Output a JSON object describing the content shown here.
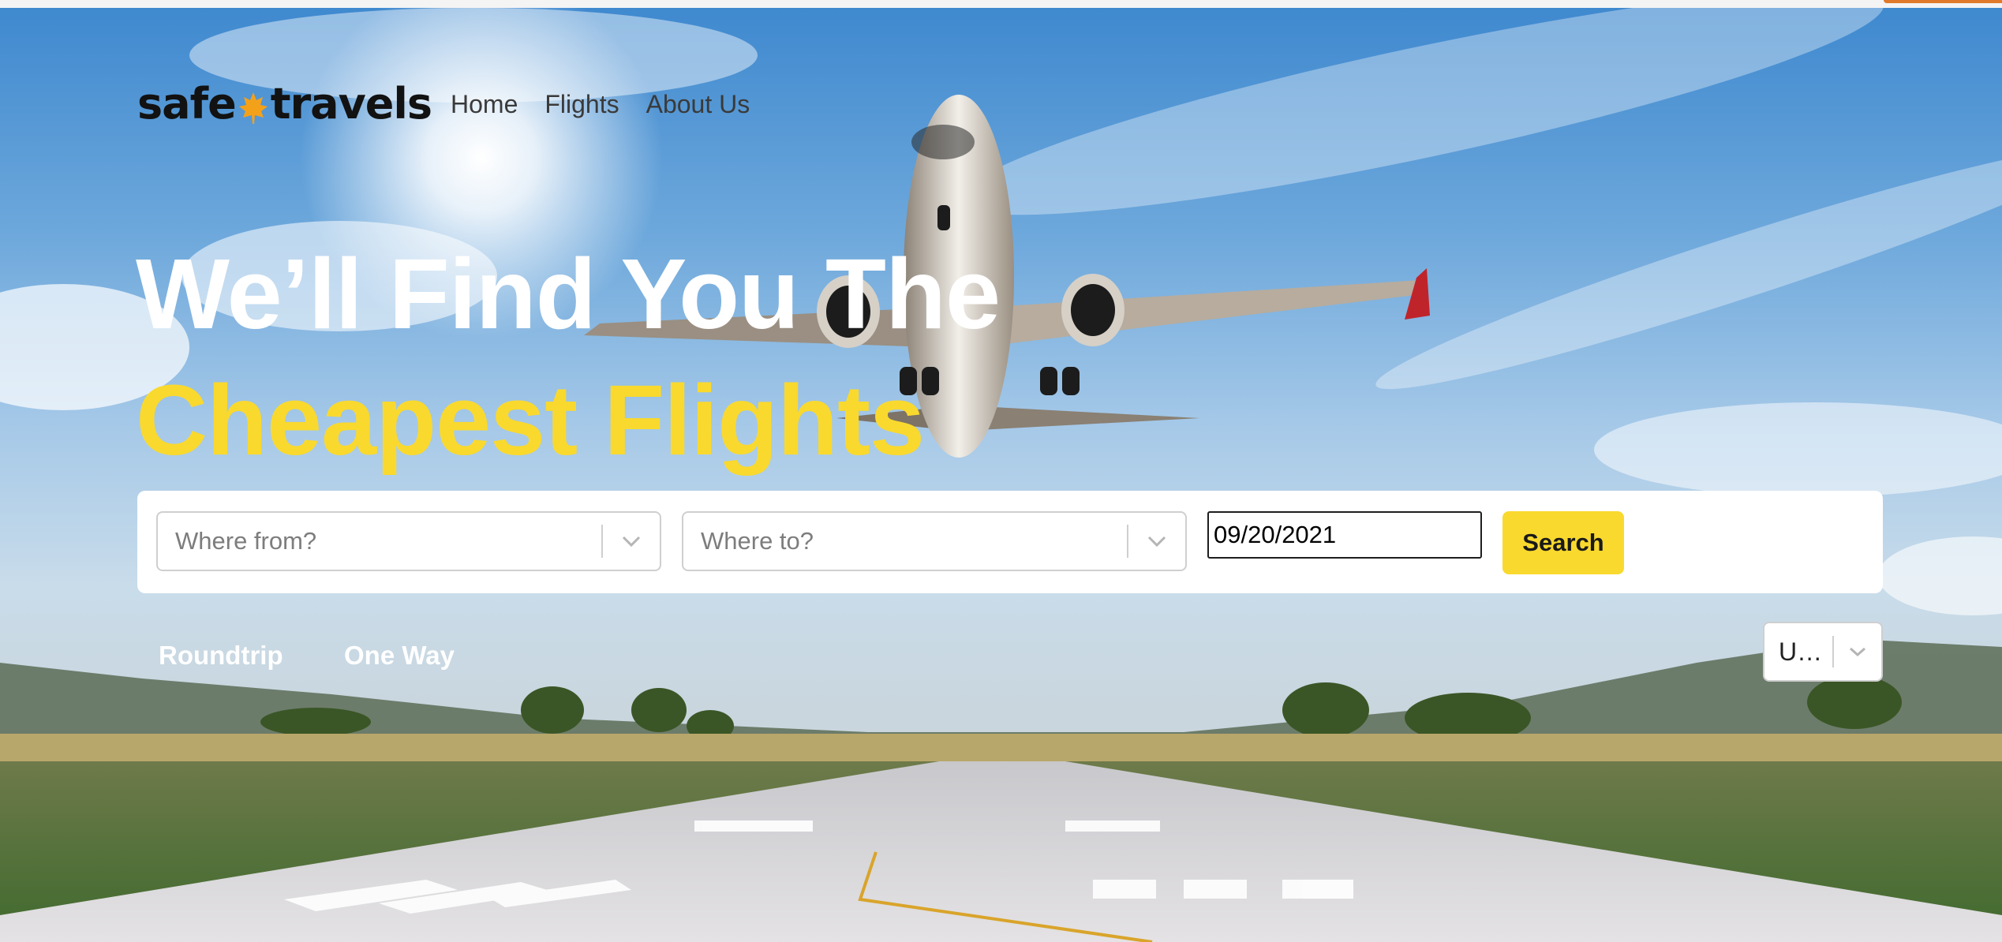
{
  "brand": {
    "name_part_1": "safe",
    "name_part_2": "travels",
    "accent_color": "#f9d92e",
    "logo_leaf_color": "#f4a11a",
    "logo_icon": "maple-leaf-icon"
  },
  "nav": {
    "items": [
      {
        "label": "Home"
      },
      {
        "label": "Flights"
      },
      {
        "label": "About Us"
      }
    ]
  },
  "hero": {
    "headline_line_1": "We’ll Find You The",
    "headline_line_2": "Cheapest Flights",
    "headline_1_color": "#ffffff",
    "headline_2_color": "#f9d92e",
    "background": "airplane-taking-off-over-runway"
  },
  "search": {
    "from": {
      "placeholder": "Where from?",
      "icon": "chevron-down-icon"
    },
    "to": {
      "placeholder": "Where to?",
      "icon": "chevron-down-icon"
    },
    "date": {
      "value": "09/20/2021"
    },
    "button_label": "Search"
  },
  "trip_type": {
    "options": [
      {
        "label": "Roundtrip"
      },
      {
        "label": "One Way"
      }
    ]
  },
  "currency": {
    "value": "U…",
    "icon": "chevron-down-icon"
  }
}
